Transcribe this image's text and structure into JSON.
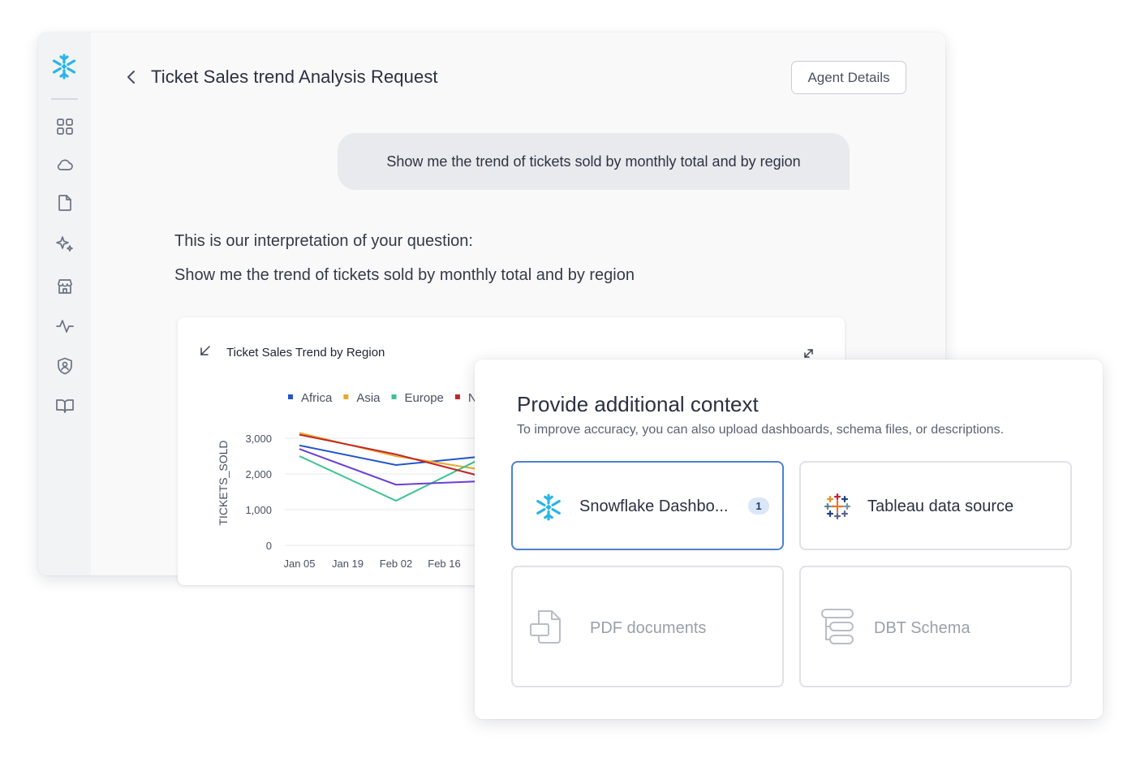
{
  "header": {
    "title": "Ticket Sales trend Analysis Request",
    "agent_details_label": "Agent Details"
  },
  "sidebar": {
    "items": [
      {
        "icon": "grid-icon"
      },
      {
        "icon": "cloud-icon"
      },
      {
        "icon": "document-icon"
      },
      {
        "icon": "sparkle-icon"
      },
      {
        "icon": "store-icon"
      },
      {
        "icon": "activity-icon"
      },
      {
        "icon": "shield-user-icon"
      },
      {
        "icon": "book-icon"
      }
    ]
  },
  "conversation": {
    "user_message": "Show me the trend of tickets sold by monthly total and by region",
    "interpretation_label": "This is our interpretation of your question:",
    "interpretation_text": "Show me the trend of tickets sold by monthly total and by region"
  },
  "colors": {
    "africa": "#2356c8",
    "asia": "#e8a92b",
    "europe": "#3cc28f",
    "n_region": "#c2252a",
    "purple_series": "#6a3fd6",
    "selected_border": "#4f7fcf"
  },
  "chart_data": {
    "type": "line",
    "title": "Ticket Sales Trend by Region",
    "xlabel": "",
    "ylabel": "TICKETS_SOLD",
    "ylim": [
      0,
      3000
    ],
    "y_ticks": [
      "3,000",
      "2,000",
      "1,000",
      "0"
    ],
    "categories": [
      "Jan 05",
      "Jan 19",
      "Feb 02",
      "Feb 16"
    ],
    "legend": [
      "Africa",
      "Asia",
      "Europe",
      "N"
    ],
    "legend_position": "top",
    "grid": true,
    "series": [
      {
        "name": "Africa",
        "color": "#2356c8",
        "values": [
          2800,
          2250,
          2500
        ]
      },
      {
        "name": "Asia",
        "color": "#e8a92b",
        "values": [
          3150,
          2500,
          2100
        ]
      },
      {
        "name": "Europe",
        "color": "#3cc28f",
        "values": [
          2500,
          1250,
          2500
        ]
      },
      {
        "color": "#c2252a",
        "values": [
          3100,
          2550,
          1900
        ]
      },
      {
        "color": "#6a3fd6",
        "values": [
          2700,
          1700,
          1800
        ]
      }
    ],
    "series_x": [
      "Jan 05",
      "Feb 02",
      "Feb 16"
    ]
  },
  "context_panel": {
    "title": "Provide additional context",
    "subtitle": "To improve accuracy, you can also upload dashboards, schema files, or descriptions.",
    "sources": [
      {
        "label": "Snowflake Dashbo...",
        "badge": "1",
        "selected": true,
        "icon": "snowflake-icon"
      },
      {
        "label": "Tableau data source",
        "selected": false,
        "icon": "tableau-icon"
      },
      {
        "label": "PDF documents",
        "selected": false,
        "icon": "pdf-icon"
      },
      {
        "label": "DBT Schema",
        "selected": false,
        "icon": "dbt-schema-icon"
      }
    ]
  }
}
